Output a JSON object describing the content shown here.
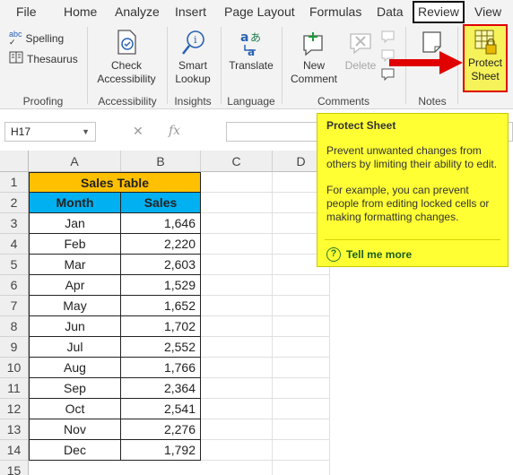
{
  "tabs": [
    "File",
    "Home",
    "Analyze",
    "Insert",
    "Page Layout",
    "Formulas",
    "Data",
    "Review",
    "View"
  ],
  "ribbon": {
    "proofing": {
      "spelling": "Spelling",
      "thesaurus": "Thesaurus",
      "label": "Proofing"
    },
    "accessibility": {
      "check_line1": "Check",
      "check_line2": "Accessibility",
      "label": "Accessibility"
    },
    "insights": {
      "smart_line1": "Smart",
      "smart_line2": "Lookup",
      "label": "Insights"
    },
    "language": {
      "translate": "Translate",
      "label": "Language"
    },
    "comments": {
      "new_line1": "New",
      "new_line2": "Comment",
      "delete": "Delete",
      "label": "Comments"
    },
    "notes": {
      "label": "Notes"
    },
    "protect": {
      "line1": "Protect",
      "line2": "Sheet"
    }
  },
  "formula_bar": {
    "name_box": "H17",
    "fx": "fx",
    "cancel": "✕",
    "enter": "✓"
  },
  "grid": {
    "columns": [
      "A",
      "B",
      "C",
      "D"
    ],
    "rows": [
      "1",
      "2",
      "3",
      "4",
      "5",
      "6",
      "7",
      "8",
      "9",
      "10",
      "11",
      "12",
      "13",
      "14",
      "15"
    ],
    "title": "Sales Table",
    "headers": {
      "month": "Month",
      "sales": "Sales"
    },
    "data": [
      {
        "month": "Jan",
        "sales": "1,646"
      },
      {
        "month": "Feb",
        "sales": "2,220"
      },
      {
        "month": "Mar",
        "sales": "2,603"
      },
      {
        "month": "Apr",
        "sales": "1,529"
      },
      {
        "month": "May",
        "sales": "1,652"
      },
      {
        "month": "Jun",
        "sales": "1,702"
      },
      {
        "month": "Jul",
        "sales": "2,552"
      },
      {
        "month": "Aug",
        "sales": "1,766"
      },
      {
        "month": "Sep",
        "sales": "2,364"
      },
      {
        "month": "Oct",
        "sales": "2,541"
      },
      {
        "month": "Nov",
        "sales": "2,276"
      },
      {
        "month": "Dec",
        "sales": "1,792"
      }
    ]
  },
  "tooltip": {
    "title": "Protect Sheet",
    "para1": "Prevent unwanted changes from others by limiting their ability to edit.",
    "para2": "For example, you can prevent people from editing locked cells or making formatting changes.",
    "link": "Tell me more"
  },
  "colors": {
    "title_fill": "#ffc000",
    "header_fill": "#00b0f0",
    "tooltip_fill": "#ffff33",
    "highlight_border": "#e00000",
    "arrow": "#e00000"
  }
}
